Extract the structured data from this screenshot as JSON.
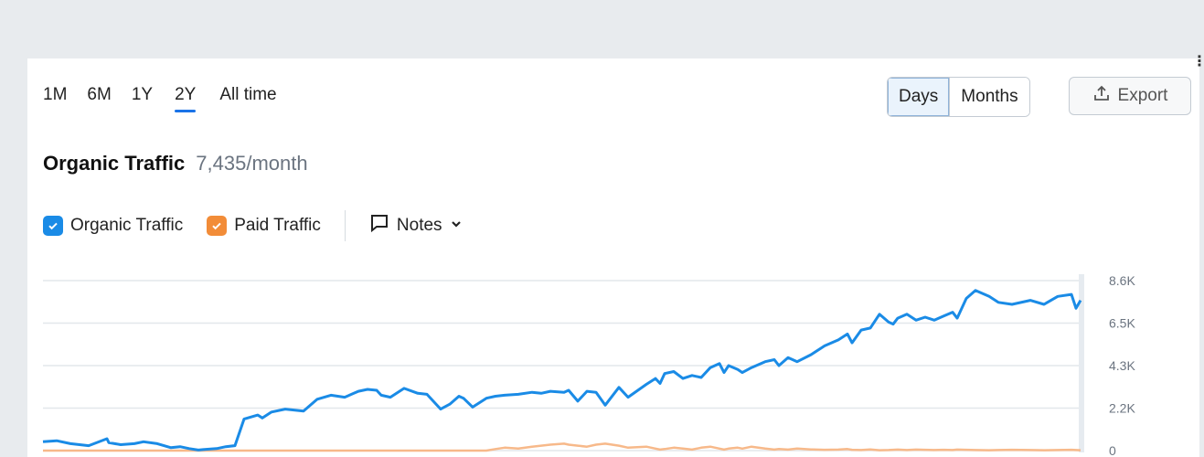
{
  "ranges": [
    "1M",
    "6M",
    "1Y",
    "2Y",
    "All time"
  ],
  "active_range": "2Y",
  "granularity": {
    "options": [
      "Days",
      "Months"
    ],
    "active": "Days"
  },
  "export": {
    "label": "Export",
    "icon": "upload-icon"
  },
  "header": {
    "title": "Organic Traffic",
    "metric": "7,435/month"
  },
  "legend": {
    "organic": {
      "label": "Organic Traffic",
      "color": "#1a8be6"
    },
    "paid": {
      "label": "Paid Traffic",
      "color": "#f28c38"
    },
    "notes": {
      "label": "Notes",
      "icon": "comment-icon",
      "chevron": "chevron-down-icon"
    }
  },
  "chart_data": {
    "type": "line",
    "x": [
      0,
      15,
      30,
      50,
      70,
      72,
      85,
      100,
      110,
      125,
      140,
      150,
      160,
      170,
      175,
      180,
      190,
      200,
      210,
      220,
      235,
      240,
      250,
      265,
      285,
      300,
      315,
      330,
      340,
      345,
      355,
      365,
      370,
      380,
      395,
      410,
      420,
      435,
      445,
      455,
      460,
      470,
      485,
      495,
      505,
      520,
      535,
      545,
      555,
      570,
      575,
      585,
      595,
      605,
      615,
      630,
      640,
      660,
      670,
      675,
      680,
      690,
      700,
      710,
      720,
      730,
      740,
      745,
      750,
      760,
      765,
      775,
      790,
      800,
      805,
      815,
      825,
      840,
      855,
      870,
      880,
      885,
      895,
      905,
      915,
      925,
      930,
      935,
      945,
      955,
      965,
      975,
      985,
      995,
      1000,
      1010,
      1020,
      1035,
      1045,
      1060,
      1080,
      1095,
      1110,
      1125,
      1130,
      1135
    ],
    "yticks": [
      "0",
      "2.2K",
      "4.3K",
      "6.5K",
      "8.6K"
    ],
    "ylim": [
      0,
      8600
    ],
    "series": [
      {
        "name": "Organic Traffic",
        "color": "#1a8be6",
        "values": [
          450,
          500,
          350,
          250,
          600,
          400,
          300,
          350,
          450,
          350,
          150,
          200,
          100,
          30,
          50,
          70,
          100,
          200,
          250,
          1600,
          1800,
          1650,
          1950,
          2100,
          2000,
          2600,
          2800,
          2700,
          2900,
          3000,
          3100,
          3050,
          2800,
          2700,
          3150,
          2900,
          2850,
          2100,
          2350,
          2750,
          2650,
          2200,
          2650,
          2750,
          2800,
          2850,
          2950,
          2900,
          3000,
          2950,
          3050,
          2500,
          3000,
          2950,
          2300,
          3200,
          2700,
          3350,
          3650,
          3400,
          3900,
          4000,
          3650,
          3800,
          3700,
          4200,
          4400,
          3950,
          4300,
          4100,
          3950,
          4200,
          4500,
          4600,
          4300,
          4700,
          4500,
          4850,
          5300,
          5600,
          5900,
          5450,
          6100,
          6200,
          6900,
          6500,
          6400,
          6700,
          6900,
          6600,
          6750,
          6600,
          6800,
          7000,
          6700,
          7700,
          8100,
          7800,
          7500,
          7400,
          7600,
          7400,
          7800,
          7900,
          7200,
          7600
        ]
      },
      {
        "name": "Paid Traffic",
        "color": "#f7b98a",
        "values": [
          0,
          0,
          0,
          0,
          0,
          0,
          0,
          0,
          0,
          0,
          0,
          0,
          0,
          0,
          0,
          0,
          0,
          0,
          0,
          0,
          0,
          0,
          0,
          0,
          0,
          0,
          0,
          0,
          0,
          0,
          0,
          0,
          0,
          0,
          0,
          0,
          0,
          0,
          0,
          0,
          0,
          0,
          0,
          80,
          150,
          100,
          200,
          250,
          300,
          350,
          300,
          250,
          200,
          300,
          350,
          250,
          150,
          200,
          100,
          50,
          80,
          150,
          100,
          50,
          150,
          200,
          100,
          50,
          100,
          150,
          100,
          200,
          100,
          50,
          80,
          50,
          100,
          60,
          40,
          50,
          80,
          40,
          30,
          60,
          20,
          30,
          40,
          50,
          30,
          50,
          40,
          30,
          40,
          30,
          50,
          40,
          30,
          20,
          30,
          40,
          30,
          20,
          30,
          40,
          30,
          20
        ]
      }
    ]
  }
}
